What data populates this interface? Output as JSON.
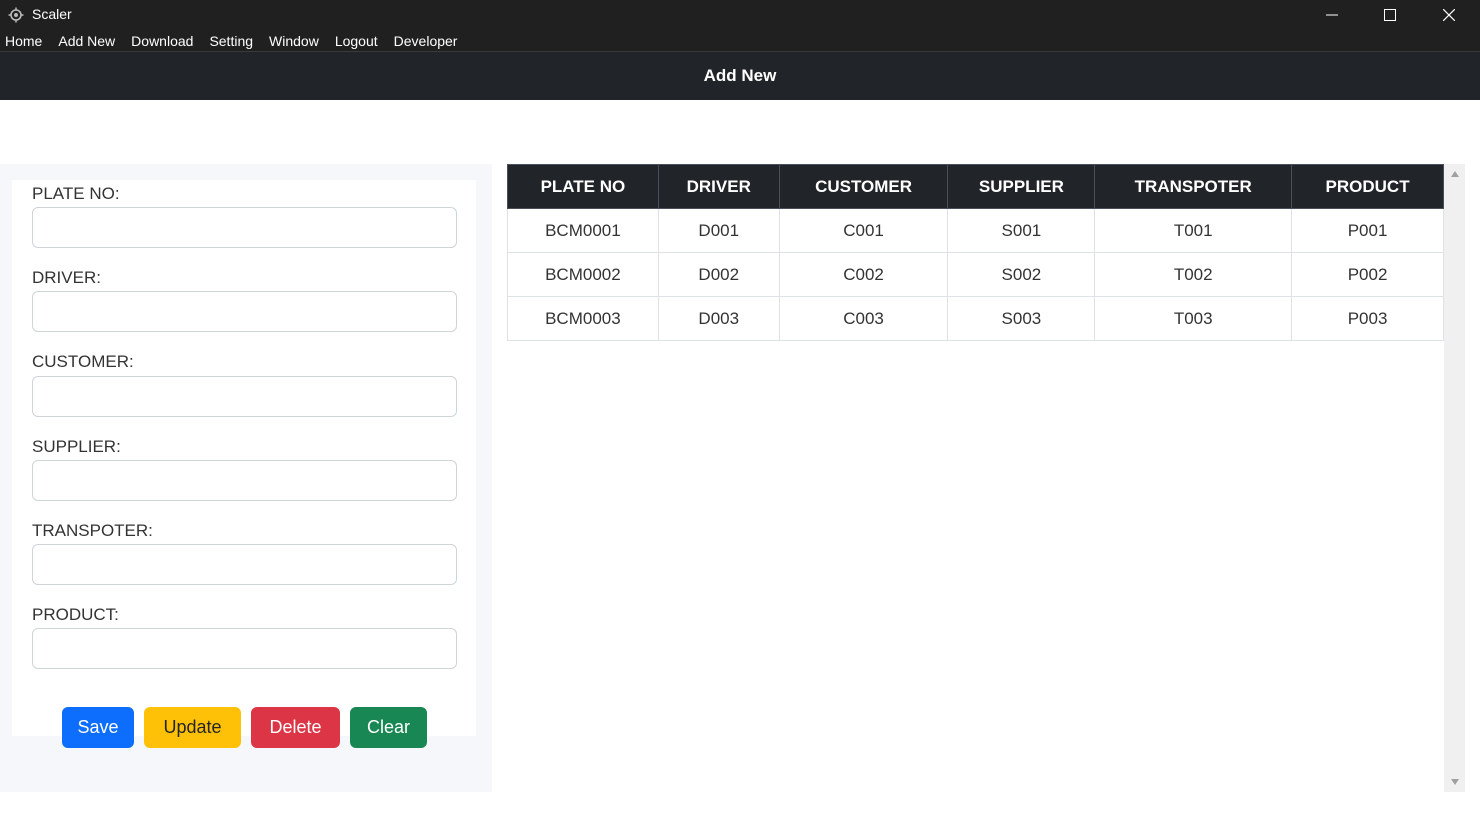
{
  "window": {
    "title": "Scaler",
    "minimize_icon": "minimize-icon",
    "maximize_icon": "maximize-icon",
    "close_icon": "close-icon"
  },
  "menu": [
    "Home",
    "Add New",
    "Download",
    "Setting",
    "Window",
    "Logout",
    "Developer"
  ],
  "header": {
    "title": "Add New"
  },
  "form": {
    "fields": [
      {
        "label": "PLATE NO:",
        "value": ""
      },
      {
        "label": "DRIVER:",
        "value": ""
      },
      {
        "label": "CUSTOMER:",
        "value": ""
      },
      {
        "label": "SUPPLIER:",
        "value": ""
      },
      {
        "label": "TRANSPOTER:",
        "value": ""
      },
      {
        "label": "PRODUCT:",
        "value": ""
      }
    ],
    "buttons": {
      "save": "Save",
      "update": "Update",
      "delete": "Delete",
      "clear": "Clear"
    }
  },
  "table": {
    "columns": [
      "PLATE NO",
      "DRIVER",
      "CUSTOMER",
      "SUPPLIER",
      "TRANSPOTER",
      "PRODUCT"
    ],
    "rows": [
      [
        "BCM0001",
        "D001",
        "C001",
        "S001",
        "T001",
        "P001"
      ],
      [
        "BCM0002",
        "D002",
        "C002",
        "S002",
        "T002",
        "P002"
      ],
      [
        "BCM0003",
        "D003",
        "C003",
        "S003",
        "T003",
        "P003"
      ]
    ]
  },
  "colors": {
    "titlebar": "#202020",
    "header": "#212529",
    "save": "#0d6efd",
    "update": "#ffc107",
    "delete": "#dc3545",
    "clear": "#198754"
  }
}
